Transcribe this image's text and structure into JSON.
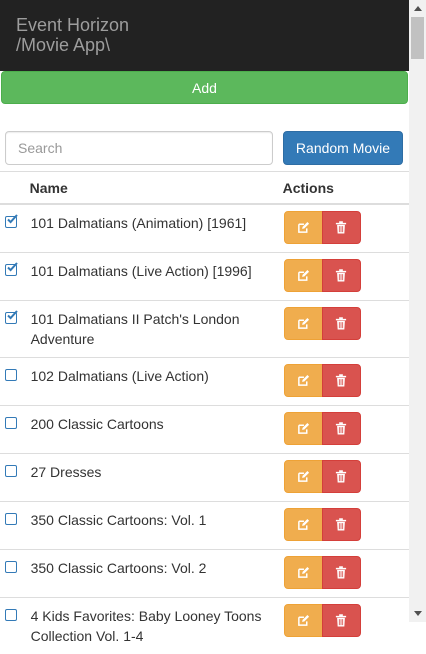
{
  "header": {
    "brand": "Event Horizon\n/Movie App\\",
    "add_label": "Add"
  },
  "search": {
    "placeholder": "Search",
    "value": ""
  },
  "random_label": "Random Movie",
  "table": {
    "headers": {
      "name": "Name",
      "actions": "Actions"
    },
    "rows": [
      {
        "title": "101 Dalmatians (Animation) [1961]",
        "checked": true
      },
      {
        "title": "101 Dalmatians (Live Action) [1996]",
        "checked": true
      },
      {
        "title": "101 Dalmatians II Patch's London Adventure",
        "checked": true
      },
      {
        "title": "102 Dalmatians (Live Action)",
        "checked": false
      },
      {
        "title": "200 Classic Cartoons",
        "checked": false
      },
      {
        "title": "27 Dresses",
        "checked": false
      },
      {
        "title": "350 Classic Cartoons: Vol. 1",
        "checked": false
      },
      {
        "title": "350 Classic Cartoons: Vol. 2",
        "checked": false
      },
      {
        "title": "4 Kids Favorites: Baby Looney Toons Collection Vol. 1-4",
        "checked": false
      }
    ]
  },
  "colors": {
    "navbar": "#222222",
    "success": "#5cb85c",
    "primary": "#337ab7",
    "warning": "#f0ad4e",
    "danger": "#d9534f"
  },
  "icons": {
    "edit": "edit-icon",
    "delete": "trash-icon",
    "checked": "checked-square-icon",
    "unchecked": "empty-square-icon"
  }
}
